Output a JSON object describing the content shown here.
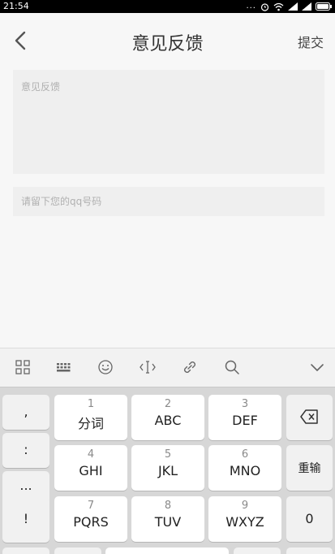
{
  "status": {
    "time": "21:54",
    "dots": "..."
  },
  "nav": {
    "title": "意见反馈",
    "submit": "提交"
  },
  "form": {
    "feedback_placeholder": "意见反馈",
    "qq_placeholder": "请留下您的qq号码"
  },
  "keyboard": {
    "left_column": [
      ",",
      ":",
      "...",
      "!"
    ],
    "keys": [
      {
        "num": "1",
        "letters": "分词"
      },
      {
        "num": "2",
        "letters": "ABC"
      },
      {
        "num": "3",
        "letters": "DEF"
      },
      {
        "num": "4",
        "letters": "GHI"
      },
      {
        "num": "5",
        "letters": "JKL"
      },
      {
        "num": "6",
        "letters": "MNO"
      },
      {
        "num": "7",
        "letters": "PQRS"
      },
      {
        "num": "8",
        "letters": "TUV"
      },
      {
        "num": "9",
        "letters": "WXYZ"
      }
    ],
    "reenter": "重输",
    "zero": "0"
  },
  "icons": {
    "back": "chevron-left-icon",
    "toolbar": [
      "grid-icon",
      "keyboard-icon",
      "emoji-icon",
      "cursor-icon",
      "link-icon",
      "search-icon",
      "chevron-down-icon"
    ],
    "delete": "backspace-icon"
  }
}
